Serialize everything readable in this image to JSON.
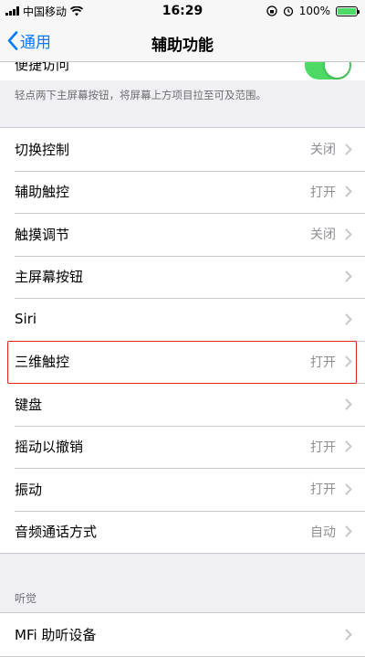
{
  "status_bar": {
    "carrier": "中国移动",
    "time": "16:29",
    "battery": "100%"
  },
  "nav": {
    "back_label": "通用",
    "title": "辅助功能"
  },
  "partial_row": {
    "label": "便捷访问",
    "toggle_on": true
  },
  "footer_note": "轻点两下主屏幕按钮，将屏幕上方项目拉至可及范围。",
  "main_rows": [
    {
      "label": "切换控制",
      "value": "关闭"
    },
    {
      "label": "辅助触控",
      "value": "打开"
    },
    {
      "label": "触摸调节",
      "value": "关闭"
    },
    {
      "label": "主屏幕按钮",
      "value": ""
    },
    {
      "label": "Siri",
      "value": ""
    },
    {
      "label": "三维触控",
      "value": "打开"
    },
    {
      "label": "键盘",
      "value": ""
    },
    {
      "label": "摇动以撤销",
      "value": "打开"
    },
    {
      "label": "振动",
      "value": "打开"
    },
    {
      "label": "音频通话方式",
      "value": "自动"
    }
  ],
  "hearing_section": {
    "header": "听觉",
    "rows": [
      {
        "label": "MFi 助听设备",
        "value": ""
      }
    ]
  },
  "colors": {
    "accent": "#007aff",
    "toggle_on": "#4cd964",
    "highlight_box": "#e1251b"
  }
}
